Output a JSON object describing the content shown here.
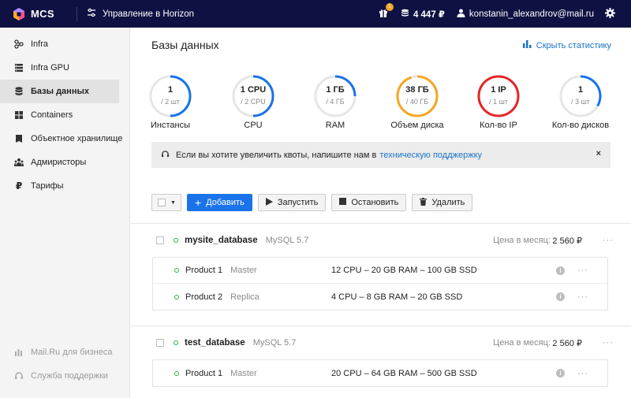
{
  "header": {
    "brand": "MCS",
    "horizon_label": "Управление в Horizon",
    "gift_badge": "1",
    "balance": "4 447 ₽",
    "user_email": "konstanin_alexandrov@mail.ru",
    "colors": {
      "bg": "#0f1143",
      "accent": "#1a73e8"
    }
  },
  "sidebar": {
    "items": [
      {
        "label": "Infra",
        "icon": "infra-icon"
      },
      {
        "label": "Infra GPU",
        "icon": "gpu-icon"
      },
      {
        "label": "Базы данных",
        "icon": "database-icon",
        "active": true
      },
      {
        "label": "Containers",
        "icon": "containers-icon"
      },
      {
        "label": "Объектное хранилище",
        "icon": "storage-icon"
      },
      {
        "label": "Адмиристоры",
        "icon": "admins-icon"
      },
      {
        "label": "Тарифы",
        "icon": "ruble-icon"
      }
    ],
    "bottom": [
      {
        "label": "Mail.Ru для бизнеса",
        "icon": "business-icon"
      },
      {
        "label": "Служба поддержки",
        "icon": "support-icon"
      }
    ]
  },
  "main": {
    "title": "Базы данных",
    "hide_stats": "Скрыть статистику",
    "stats": [
      {
        "value": "1",
        "total": "/ 2 шт",
        "label": "Инстансы",
        "fraction": 0.5,
        "color": "#1a73e8"
      },
      {
        "value": "1 CPU",
        "total": "/ 2 CPU",
        "label": "CPU",
        "fraction": 0.5,
        "color": "#1a73e8"
      },
      {
        "value": "1 ГБ",
        "total": "/ 4 ГБ",
        "label": "RAM",
        "fraction": 0.25,
        "color": "#1a73e8"
      },
      {
        "value": "38 ГБ",
        "total": "/ 40 ГБ",
        "label": "Объем диска",
        "fraction": 0.95,
        "color": "#f5a623"
      },
      {
        "value": "1 IP",
        "total": "/ 1 шт",
        "label": "Кол-во IP",
        "fraction": 1.0,
        "color": "#e5252a"
      },
      {
        "value": "1",
        "total": "/ 3 шт",
        "label": "Кол-во дисков",
        "fraction": 0.333,
        "color": "#1a73e8"
      }
    ],
    "notice": {
      "text": "Если вы хотите увеличить квоты, напишите нам в",
      "link": "техническую подджержку",
      "close": "×"
    },
    "toolbar": {
      "add": "Добавить",
      "start": "Запустить",
      "stop": "Остановить",
      "delete": "Удалить"
    },
    "price_label": "Цена в месяц:",
    "databases": [
      {
        "name": "mysite_database",
        "type": "MySQL 5.7",
        "price": "2 560 ₽",
        "products": [
          {
            "name": "Product 1",
            "role": "Master",
            "config": "12 CPU – 20 GB RAM – 100 GB SSD"
          },
          {
            "name": "Product 2",
            "role": "Replica",
            "config": "4 CPU – 8 GB RAM – 20 GB SSD"
          }
        ]
      },
      {
        "name": "test_database",
        "type": "MySQL 5.7",
        "price": "2 560 ₽",
        "products": [
          {
            "name": "Product 1",
            "role": "Master",
            "config": "20 CPU – 64 GB RAM – 500 GB SSD"
          }
        ]
      }
    ]
  }
}
